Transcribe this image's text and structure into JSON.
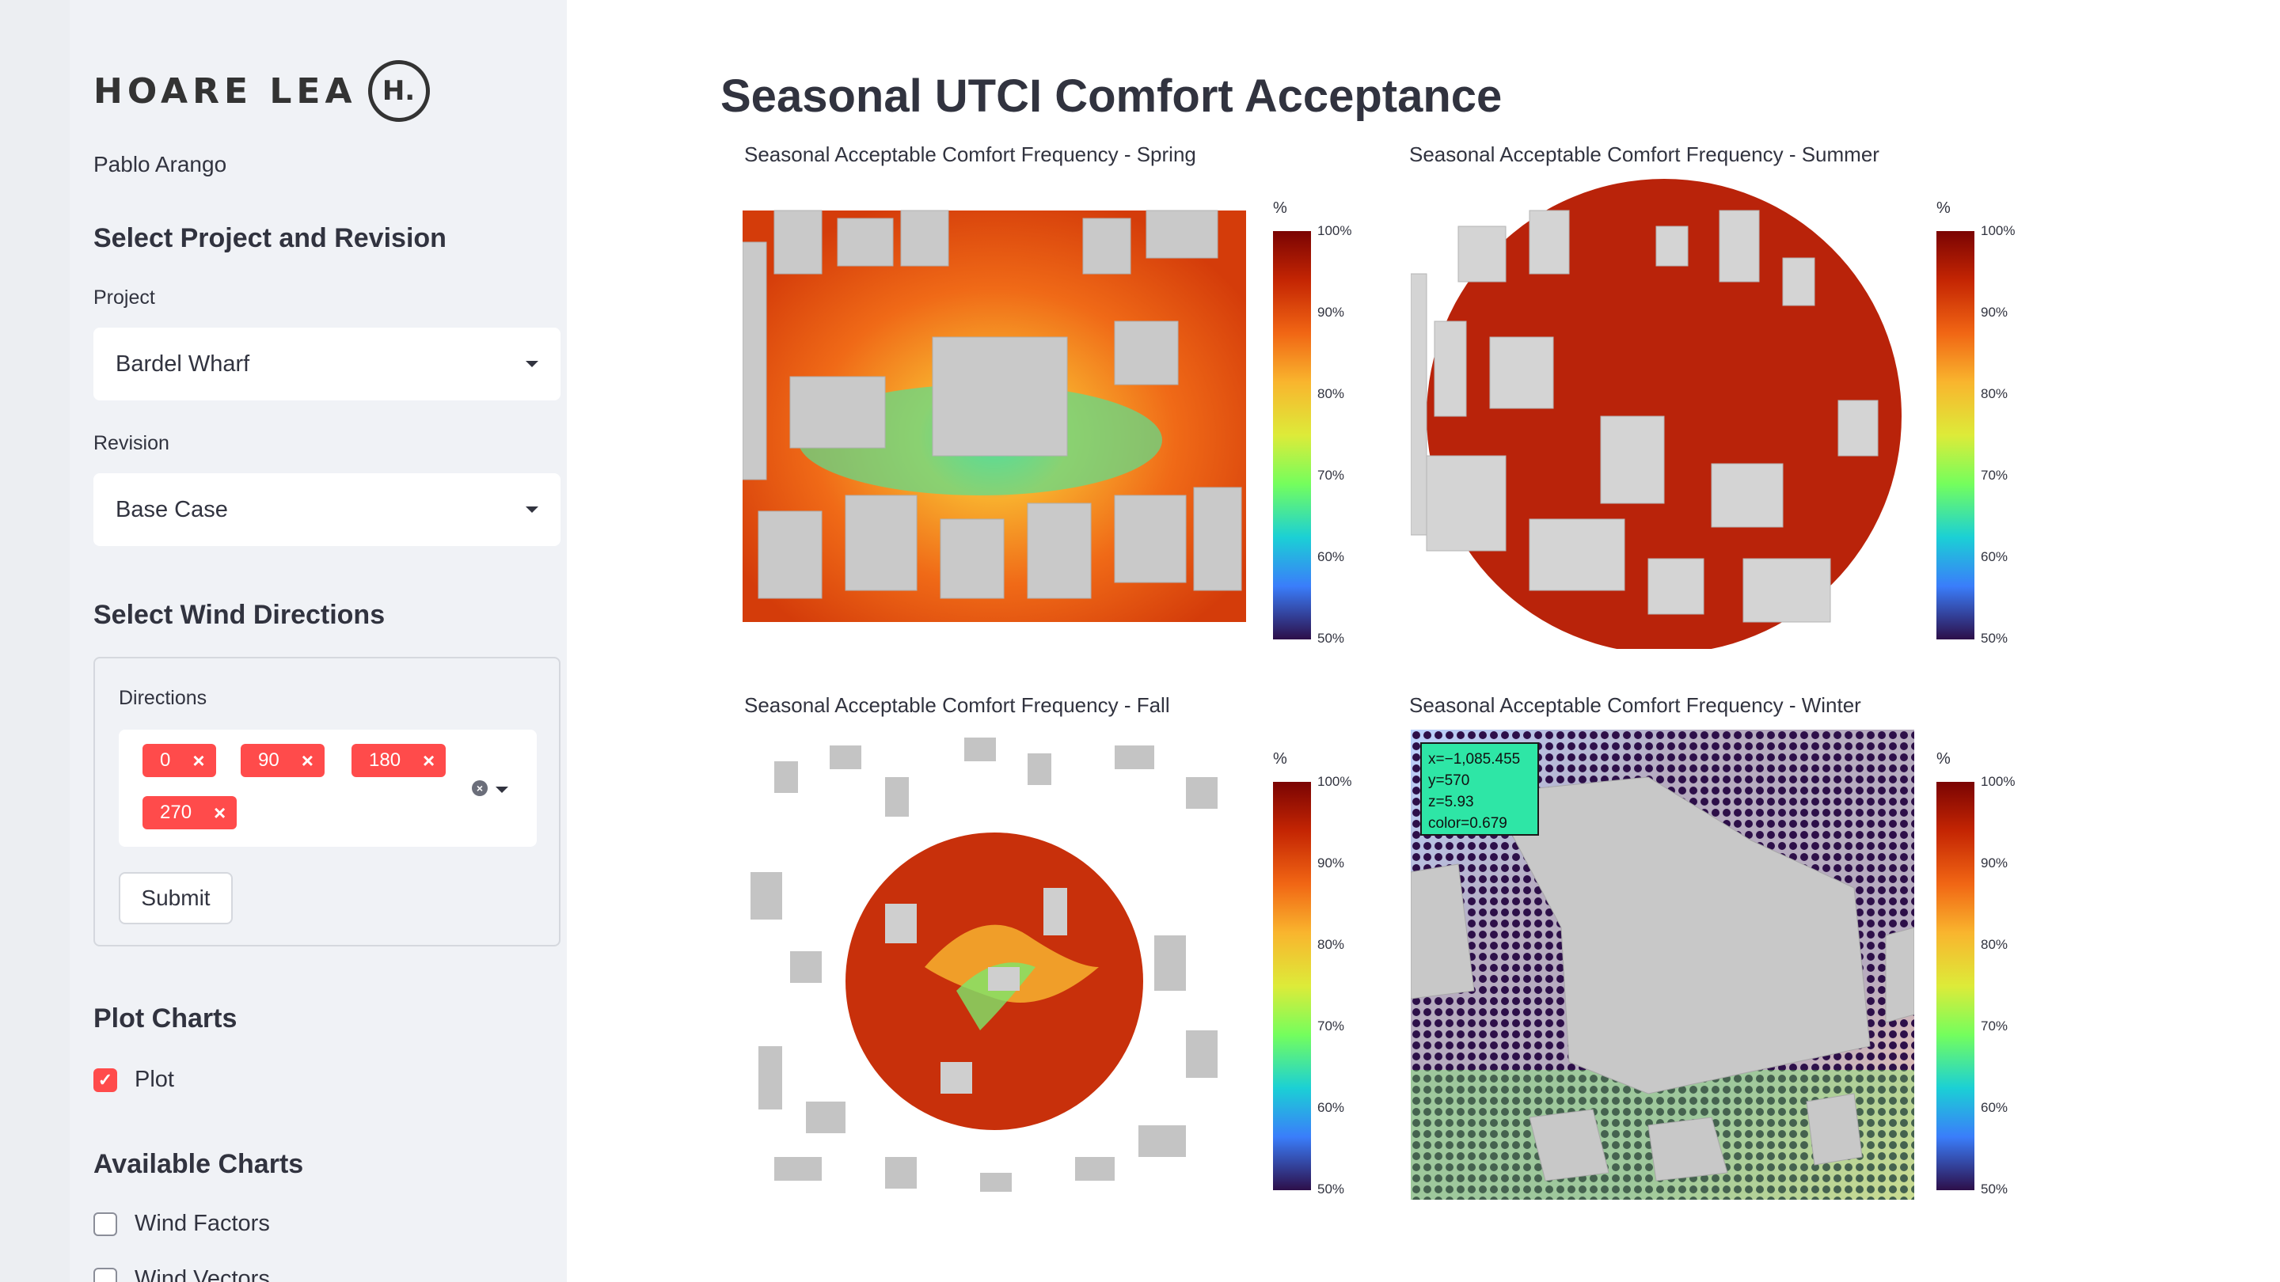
{
  "sidebar": {
    "logo_text": "HOARE LEA",
    "logo_mark": "H.",
    "user_name": "Pablo Arango",
    "section_project": "Select Project and Revision",
    "project_label": "Project",
    "project_value": "Bardel Wharf",
    "revision_label": "Revision",
    "revision_value": "Base Case",
    "section_wind": "Select Wind Directions",
    "directions_label": "Directions",
    "directions": [
      "0",
      "90",
      "180",
      "270"
    ],
    "submit_label": "Submit",
    "section_plot": "Plot Charts",
    "plot_label": "Plot",
    "section_available": "Available Charts",
    "chart_options": [
      "Wind Factors",
      "Wind Vectors"
    ]
  },
  "main": {
    "title": "Seasonal UTCI Comfort Acceptance",
    "panels": [
      {
        "title": "Seasonal Acceptable Comfort Frequency - Spring"
      },
      {
        "title": "Seasonal Acceptable Comfort Frequency - Summer"
      },
      {
        "title": "Seasonal Acceptable Comfort Frequency - Fall"
      },
      {
        "title": "Seasonal Acceptable Comfort Frequency - Winter"
      }
    ],
    "colorbar": {
      "unit": "%",
      "ticks": [
        "100%",
        "90%",
        "80%",
        "70%",
        "60%",
        "50%"
      ]
    },
    "tooltip": {
      "x": "x=−1,085.455",
      "y": "y=570",
      "z": "z=5.93",
      "color": "color=0.679"
    }
  },
  "colors": {
    "accent": "#ff4b4b",
    "sidebar_bg": "#f0f2f6",
    "tooltip_bg": "#2ee6a6"
  }
}
